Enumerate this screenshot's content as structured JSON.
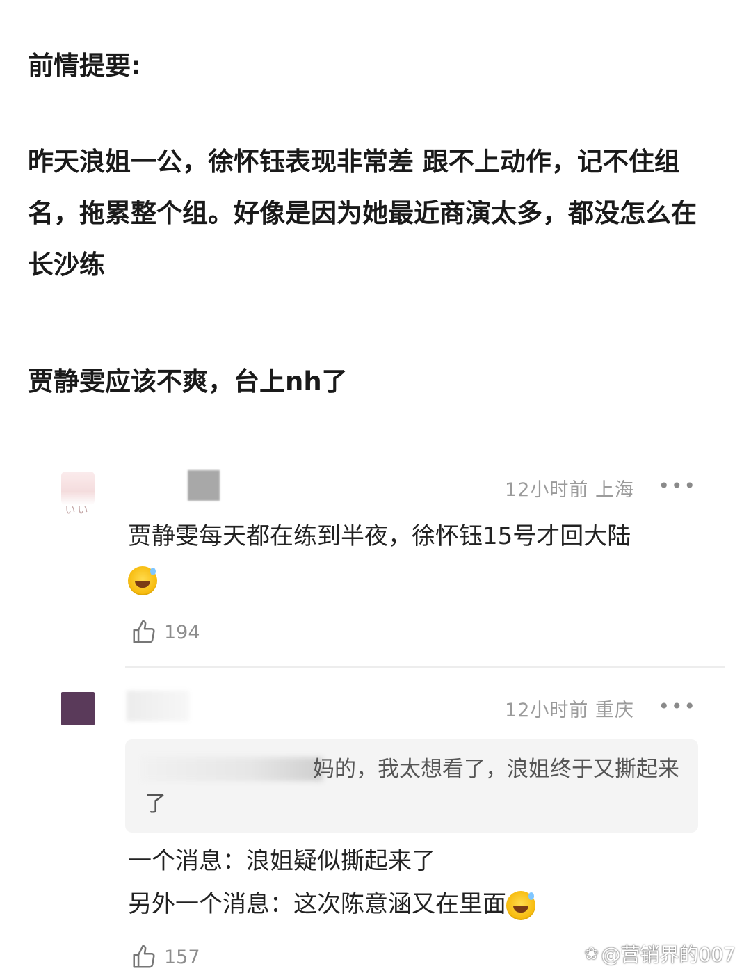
{
  "post": {
    "title": "前情提要:",
    "paragraph1": "昨天浪姐一公，徐怀钰表现非常差 跟不上动作，记不住组名，拖累整个组。好像是因为她最近商演太多，都没怎么在长沙练",
    "paragraph2": "贾静雯应该不爽，台上nh了"
  },
  "comments": [
    {
      "meta": "12小时前 上海",
      "text": "贾静雯每天都在练到半夜，徐怀钰15号才回大陆",
      "emoji": "grinning-sweat-emoji",
      "likes": "194"
    },
    {
      "meta": "12小时前 重庆",
      "quote": "妈的，我太想看了，浪姐终于又撕起来了",
      "line1": "一个消息：浪姐疑似撕起来了",
      "line2": "另外一个消息：这次陈意涵又在里面",
      "emoji": "grinning-sweat-emoji",
      "likes": "157"
    }
  ],
  "more_icon": "more-dots-icon",
  "like_icon": "thumbs-up-icon",
  "watermark": {
    "icon": "paw-icon",
    "text": "@营销界的007"
  },
  "colors": {
    "text": "#1a1a1a",
    "meta": "#9b9b9b",
    "quote_bg": "#f4f4f4"
  }
}
